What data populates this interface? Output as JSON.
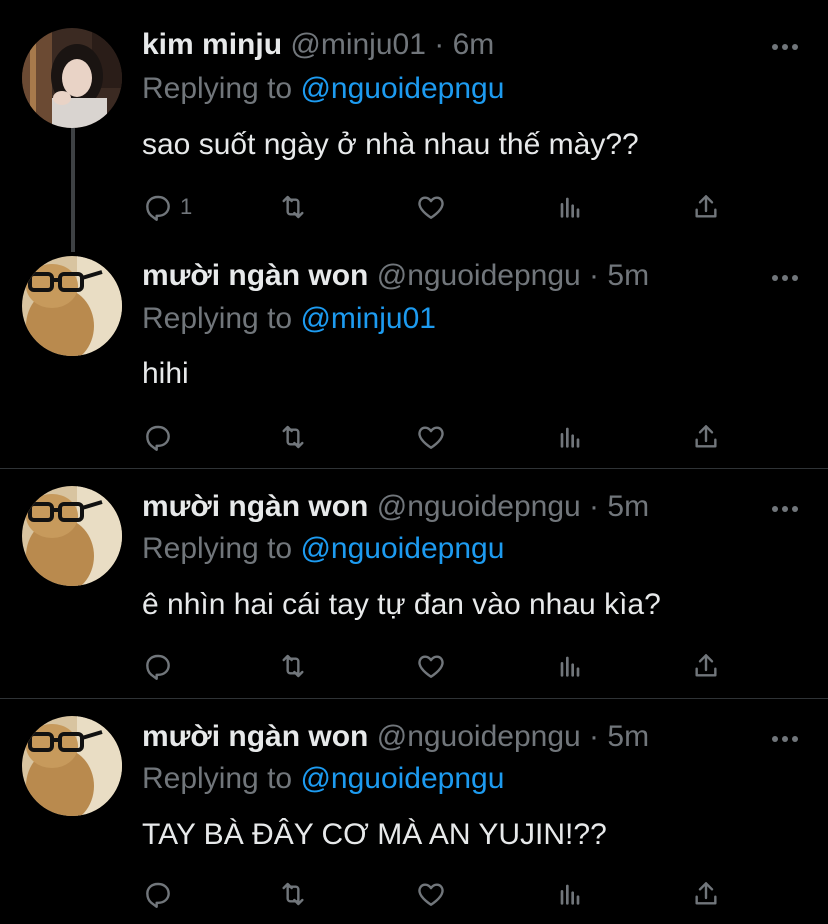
{
  "colors": {
    "background": "#000000",
    "text": "#e7e9ea",
    "muted": "#71767b",
    "link": "#1d9bf0",
    "divider": "#2f3336"
  },
  "tweets": [
    {
      "name": "kim minju",
      "handle": "@minju01",
      "dot": "·",
      "time": "6m",
      "replying_prefix": "Replying to",
      "replying_to": "@nguoidepngu",
      "text": "sao suốt ngày ở nhà nhau thế mày??",
      "reply_count": "1",
      "avatar_icon": "avatar-photo-girl"
    },
    {
      "name": "mười ngàn won",
      "handle": "@nguoidepngu",
      "dot": "·",
      "time": "5m",
      "replying_prefix": "Replying to",
      "replying_to": "@minju01",
      "text": "hihi",
      "reply_count": "",
      "avatar_icon": "avatar-rabbit-glasses"
    },
    {
      "name": "mười ngàn won",
      "handle": "@nguoidepngu",
      "dot": "·",
      "time": "5m",
      "replying_prefix": "Replying to",
      "replying_to": "@nguoidepngu",
      "text": "ê nhìn hai cái tay tự đan vào nhau kìa?",
      "reply_count": "",
      "avatar_icon": "avatar-rabbit-glasses"
    },
    {
      "name": "mười ngàn won",
      "handle": "@nguoidepngu",
      "dot": "·",
      "time": "5m",
      "replying_prefix": "Replying to",
      "replying_to": "@nguoidepngu",
      "text": "TAY BÀ ĐÂY CƠ MÀ AN YUJIN!??",
      "reply_count": "",
      "avatar_icon": "avatar-rabbit-glasses"
    }
  ]
}
